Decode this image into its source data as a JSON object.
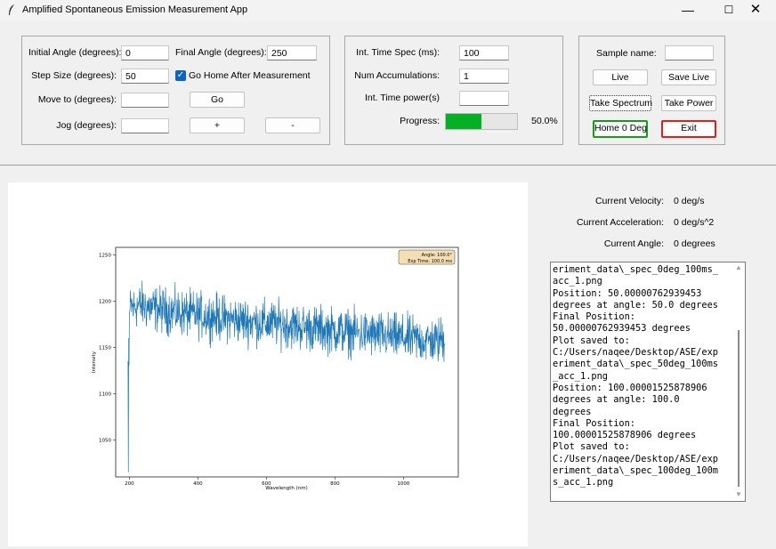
{
  "window": {
    "title": "Amplified Spontaneous Emission Measurement App",
    "minimize_glyph": "—",
    "maximize_glyph": "☐",
    "close_glyph": "✕"
  },
  "angle_panel": {
    "initial_angle_label": "Initial Angle (degrees):",
    "initial_angle_value": "0",
    "final_angle_label": "Final Angle (degrees):",
    "final_angle_value": "250",
    "step_size_label": "Step Size (degrees):",
    "step_size_value": "50",
    "go_home_label": "Go Home After Measurement",
    "go_home_checked": true,
    "move_to_label": "Move to (degrees):",
    "move_to_value": "",
    "go_button": "Go",
    "jog_label": "Jog (degrees):",
    "jog_value": "",
    "jog_plus_button": "+",
    "jog_minus_button": "-"
  },
  "spec_panel": {
    "int_time_label": "Int. Time Spec (ms):",
    "int_time_value": "100",
    "num_acc_label": "Num Accumulations:",
    "num_acc_value": "1",
    "int_time_power_label": "Int. Time power(s)",
    "int_time_power_value": "",
    "progress_label": "Progress:",
    "progress_fraction": 0.5,
    "progress_text": "50.0%",
    "progress_color": "#06b025"
  },
  "sample_panel": {
    "sample_name_label": "Sample name:",
    "sample_name_value": "",
    "live_button": "Live",
    "save_live_button": "Save Live",
    "take_spectrum_button": "Take Spectrum",
    "take_power_button": "Take Power",
    "home_button": "Home 0 Deg",
    "home_button_color": "#1a9a1a",
    "exit_button": "Exit",
    "exit_button_color": "#e0201c"
  },
  "status": {
    "velocity_label": "Current Velocity:",
    "velocity_value": "0 deg/s",
    "acceleration_label": "Current Acceleration:",
    "acceleration_value": "0 deg/s^2",
    "angle_label": "Current Angle:",
    "angle_value": "0 degrees"
  },
  "console": {
    "lines": [
      "eriment_data\\_spec_0deg_100ms_",
      "acc_1.png",
      "Position: 50.00000762939453",
      "degrees at angle: 50.0 degrees",
      "Final Position:",
      "50.00000762939453 degrees",
      "Plot saved to:",
      "C:/Users/naqee/Desktop/ASE/exp",
      "eriment_data\\_spec_50deg_100ms",
      "_acc_1.png",
      "Position: 100.00001525878906",
      "degrees at angle: 100.0",
      "degrees",
      "Final Position:",
      "100.00001525878906 degrees",
      "Plot saved to:",
      "C:/Users/naqee/Desktop/ASE/exp",
      "eriment_data\\_spec_100deg_100m",
      "s_acc_1.png"
    ]
  },
  "chart_data": {
    "type": "line",
    "xlabel": "Wavelength (nm)",
    "ylabel": "Intensity",
    "xlim": [
      160,
      1160
    ],
    "ylim": [
      1010,
      1258
    ],
    "xticks": [
      200,
      400,
      600,
      800,
      1000
    ],
    "yticks": [
      1050,
      1100,
      1150,
      1200,
      1250
    ],
    "line_color": "#1f77b4",
    "legend_box": [
      "Angle: 100.0°",
      "Exp Time: 100.0 ms"
    ],
    "legend_box_color": "#f5deb3",
    "legend_position": "top-right",
    "series": [
      {
        "x": [
          196,
          197,
          198,
          199,
          200,
          202,
          206,
          210,
          220,
          240,
          260,
          300,
          350,
          400,
          450,
          500,
          550,
          600,
          650,
          700,
          750,
          800,
          850,
          900,
          950,
          1000,
          1050,
          1080,
          1100,
          1110,
          1120
        ],
        "y": [
          1135,
          1015,
          1160,
          1130,
          1185,
          1190,
          1195,
          1192,
          1195,
          1195,
          1193,
          1190,
          1187,
          1185,
          1183,
          1180,
          1178,
          1176,
          1175,
          1172,
          1170,
          1168,
          1166,
          1164,
          1162,
          1160,
          1158,
          1157,
          1156,
          1160,
          1158
        ],
        "noise_amplitude": 22
      }
    ]
  }
}
